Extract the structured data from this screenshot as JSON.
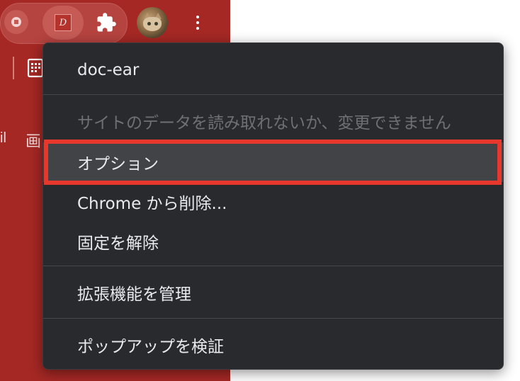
{
  "toolbar": {
    "record_ext_icon": "record-icon",
    "docear_ext_icon": "docear-icon",
    "docear_badge_text": "D",
    "extensions_icon": "puzzle-icon",
    "profile_icon": "avatar-cat",
    "menu_icon": "three-dot-vertical-icon"
  },
  "page_fragments": {
    "left_text": "il",
    "kanji_text": "画"
  },
  "context_menu": {
    "title": "doc-ear",
    "site_access": "サイトのデータを読み取れないか、変更できません",
    "options": "オプション",
    "remove": "Chrome から削除...",
    "unpin": "固定を解除",
    "manage": "拡張機能を管理",
    "inspect_popup": "ポップアップを検証"
  },
  "colors": {
    "chrome_theme": "#a52824",
    "menu_bg": "#292a2d",
    "menu_text": "#e8eaed",
    "menu_disabled_text": "#6e7073",
    "highlight_outline": "#e8382d"
  }
}
